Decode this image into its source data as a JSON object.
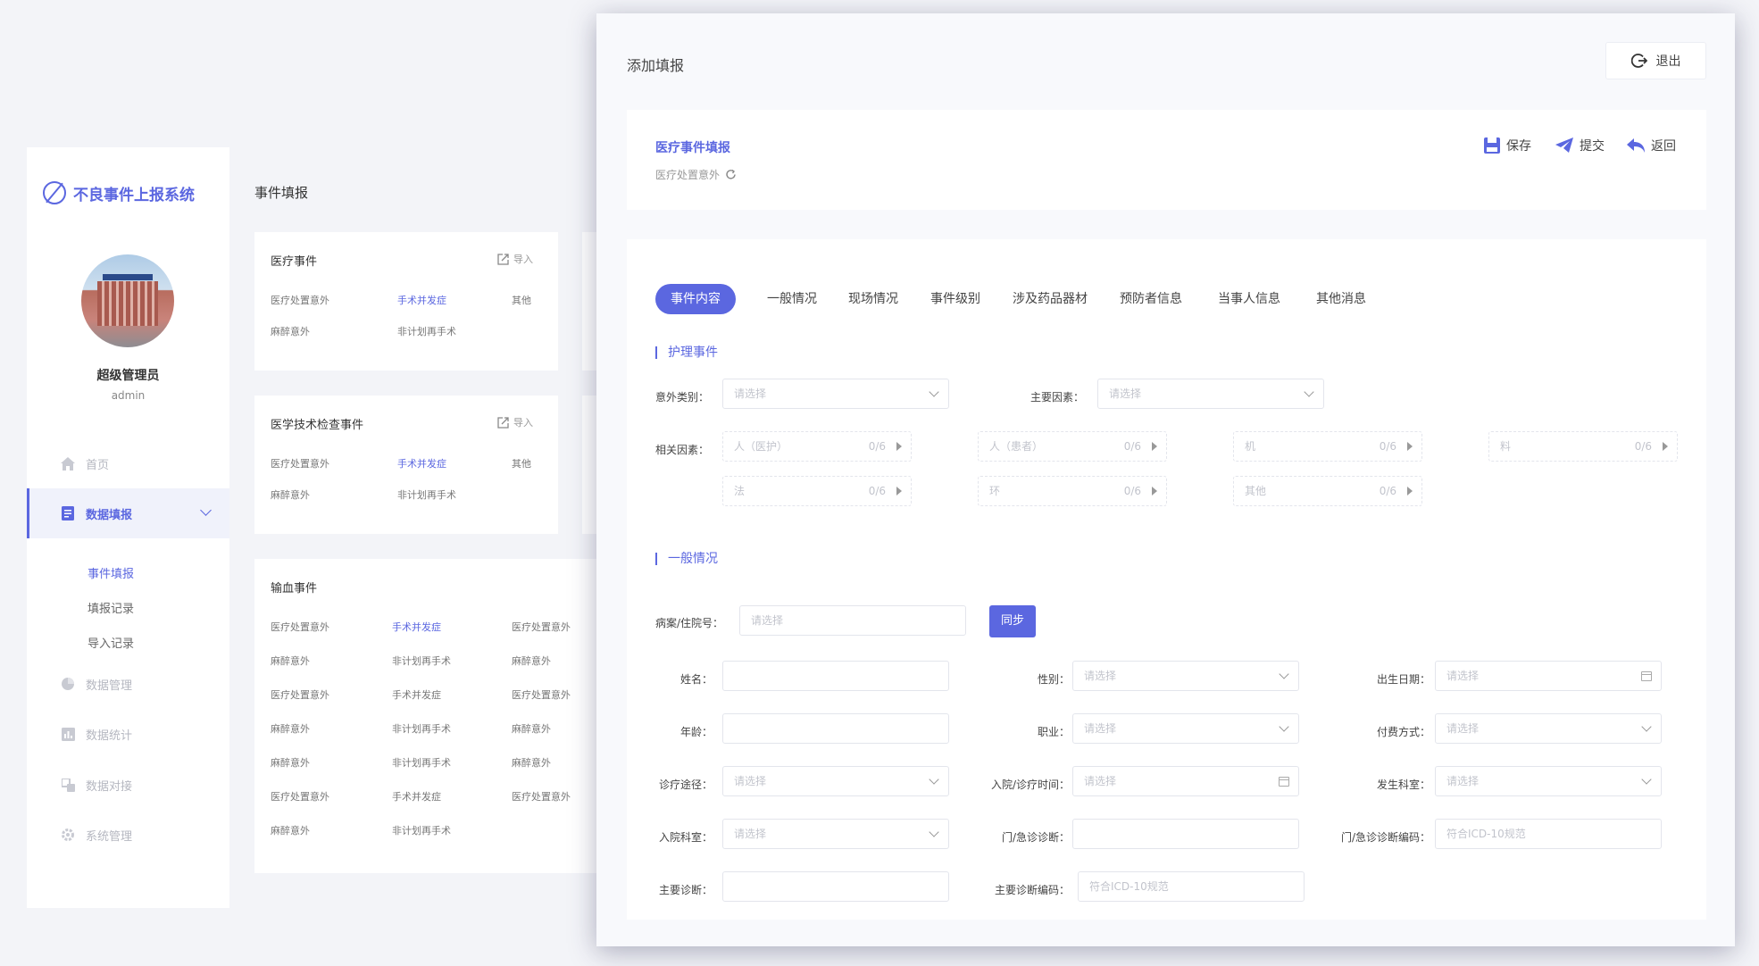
{
  "app": {
    "title": "不良事件上报系统"
  },
  "user": {
    "name": "超级管理员",
    "role": "admin"
  },
  "nav": {
    "home": "首页",
    "data_entry": "数据填报",
    "sub_items": [
      "事件填报",
      "填报记录",
      "导入记录"
    ],
    "data_manage": "数据管理",
    "data_stats": "数据统计",
    "data_connect": "数据对接",
    "system_manage": "系统管理"
  },
  "background": {
    "page_title": "事件填报",
    "cards": [
      {
        "title": "医疗事件",
        "import": "导入",
        "items": [
          "医疗处置意外",
          "手术并发症",
          "其他",
          "麻醉意外",
          "非计划再手术"
        ]
      },
      {
        "title": "医学技术检查事件",
        "import": "导入",
        "items": [
          "医疗处置意外",
          "手术并发症",
          "其他",
          "麻醉意外",
          "非计划再手术"
        ]
      },
      {
        "title": "输血事件",
        "items": [
          [
            "医疗处置意外",
            "手术并发症",
            "医疗处置意外"
          ],
          [
            "麻醉意外",
            "非计划再手术",
            "麻醉意外"
          ],
          [
            "医疗处置意外",
            "手术并发症",
            "医疗处置意外"
          ],
          [
            "麻醉意外",
            "非计划再手术",
            "麻醉意外"
          ],
          [
            "麻醉意外",
            "非计划再手术",
            "麻醉意外"
          ],
          [
            "医疗处置意外",
            "手术并发症",
            "医疗处置意外"
          ],
          [
            "麻醉意外",
            "非计划再手术"
          ]
        ]
      }
    ]
  },
  "modal": {
    "title": "添加填报",
    "exit": "退出",
    "header": {
      "title": "医疗事件填报",
      "subtitle": "医疗处置意外",
      "save": "保存",
      "submit": "提交",
      "back": "返回"
    },
    "tabs": [
      "事件内容",
      "一般情况",
      "现场情况",
      "事件级别",
      "涉及药品器材",
      "预防者信息",
      "当事人信息",
      "其他消息"
    ],
    "nursing": {
      "section_title": "护理事件",
      "accident_type_label": "意外类别：",
      "accident_type_placeholder": "请选择",
      "main_factor_label": "主要因素：",
      "main_factor_placeholder": "请选择",
      "related_factor_label": "相关因素：",
      "factors": [
        {
          "name": "人（医护）",
          "count": "0/6"
        },
        {
          "name": "人（患者）",
          "count": "0/6"
        },
        {
          "name": "机",
          "count": "0/6"
        },
        {
          "name": "料",
          "count": "0/6"
        },
        {
          "name": "法",
          "count": "0/6"
        },
        {
          "name": "环",
          "count": "0/6"
        },
        {
          "name": "其他",
          "count": "0/6"
        }
      ]
    },
    "general": {
      "section_title": "一般情况",
      "record_no_label": "病案/住院号：",
      "record_no_placeholder": "请选择",
      "sync": "同步",
      "name_label": "姓名：",
      "name_value": "",
      "gender_label": "性别：",
      "gender_placeholder": "请选择",
      "birth_label": "出生日期：",
      "birth_placeholder": "请选择",
      "age_label": "年龄：",
      "age_value": "",
      "job_label": "职业：",
      "job_placeholder": "请选择",
      "pay_label": "付费方式：",
      "pay_placeholder": "请选择",
      "route_label": "诊疗途径：",
      "route_placeholder": "请选择",
      "admit_time_label": "入院/诊疗时间：",
      "admit_time_placeholder": "请选择",
      "dept_label": "发生科室：",
      "dept_placeholder": "请选择",
      "admit_dept_label": "入院科室：",
      "admit_dept_placeholder": "请选择",
      "er_diag_label": "门/急诊诊断：",
      "er_diag_value": "",
      "er_code_label": "门/急诊诊断编码：",
      "er_code_placeholder": "符合ICD-10规范",
      "main_diag_label": "主要诊断：",
      "main_diag_value": "",
      "main_code_label": "主要诊断编码：",
      "main_code_placeholder": "符合ICD-10规范"
    }
  },
  "colors": {
    "accent": "#5b67e0",
    "page_bg": "#f3f4f8",
    "muted": "#c2c4cc"
  }
}
